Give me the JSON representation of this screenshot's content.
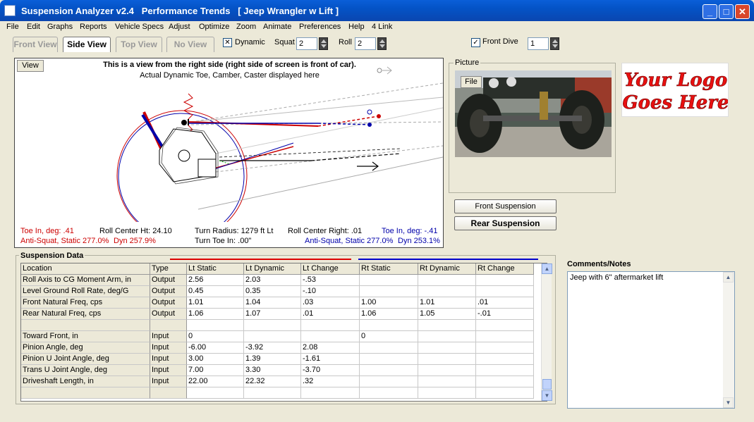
{
  "window": {
    "title": "Suspension Analyzer v2.4   Performance Trends   [ Jeep Wrangler w Lift ]"
  },
  "menu": [
    "File",
    "Edit",
    "Graphs",
    "Reports",
    "Vehicle Specs",
    "Adjust",
    "Optimize",
    "Zoom",
    "Animate",
    "Preferences",
    "Help",
    "4 Link"
  ],
  "tabs": [
    "Front View",
    "Side View",
    "Top View",
    "No View"
  ],
  "toolbar": {
    "dynamic_label": "Dynamic",
    "squat_label": "Squat",
    "squat_value": "2",
    "roll_label": "Roll",
    "roll_value": "2",
    "front_dive_label": "Front Dive",
    "front_dive_value": "1"
  },
  "view": {
    "button": "View",
    "title": "This is a view from the right side (right side of screen is front of car).",
    "subtitle": "Actual Dynamic Toe, Camber, Caster displayed here",
    "info": {
      "lt_toe": "Toe In, deg: .41",
      "roll_center_ht": "Roll Center Ht: 24.10",
      "turn_radius": "Turn Radius: 1279 ft Lt",
      "roll_center_right": "Roll Center Right: .01",
      "rt_toe": "Toe In, deg: -.41",
      "lt_anti_squat": "Anti-Squat, Static 277.0%",
      "lt_dyn": "Dyn 257.9%",
      "turn_toe_in": "Turn Toe In: .00\"",
      "rt_anti_squat": "Anti-Squat, Static 277.0%",
      "rt_dyn": "Dyn 253.1%"
    }
  },
  "picture": {
    "legend": "Picture",
    "file_button": "File"
  },
  "logo": {
    "line1": "Your Logo",
    "line2": "Goes Here"
  },
  "buttons": {
    "front": "Front Suspension",
    "rear": "Rear Suspension"
  },
  "suspension_data": {
    "legend": "Suspension Data",
    "headers": [
      "Location",
      "Type",
      "Lt Static",
      "Lt Dynamic",
      "Lt Change",
      "Rt Static",
      "Rt Dynamic",
      "Rt Change"
    ],
    "rows": [
      [
        "Roll Axis to CG Moment Arm, in",
        "Output",
        "2.56",
        "2.03",
        "-.53",
        "",
        "",
        ""
      ],
      [
        "Level Ground Roll Rate, deg/G",
        "Output",
        "0.45",
        "0.35",
        "-.10",
        "",
        "",
        ""
      ],
      [
        "Front Natural Freq, cps",
        "Output",
        "1.01",
        "1.04",
        ".03",
        "1.00",
        "1.01",
        ".01"
      ],
      [
        "Rear Natural Freq, cps",
        "Output",
        "1.06",
        "1.07",
        ".01",
        "1.06",
        "1.05",
        "-.01"
      ],
      [
        "",
        "",
        "",
        "",
        "",
        "",
        "",
        ""
      ],
      [
        "Toward Front, in",
        "Input",
        "0",
        "",
        "",
        "0",
        "",
        ""
      ],
      [
        "Pinion Angle, deg",
        "Input",
        "-6.00",
        "-3.92",
        "2.08",
        "",
        "",
        ""
      ],
      [
        "Pinion U Joint Angle, deg",
        "Input",
        "3.00",
        "1.39",
        "-1.61",
        "",
        "",
        ""
      ],
      [
        "Trans U Joint Angle, deg",
        "Input",
        "7.00",
        "3.30",
        "-3.70",
        "",
        "",
        ""
      ],
      [
        "Driveshaft Length, in",
        "Input",
        "22.00",
        "22.32",
        ".32",
        "",
        "",
        ""
      ],
      [
        "",
        "",
        "",
        "",
        "",
        "",
        "",
        ""
      ]
    ]
  },
  "comments": {
    "label": "Comments/Notes",
    "text": "Jeep with 6\" aftermarket lift"
  }
}
